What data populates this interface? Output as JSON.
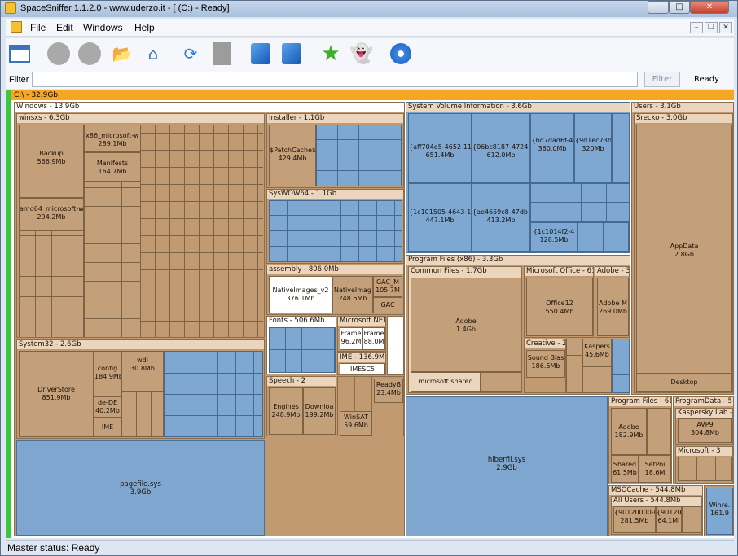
{
  "title": "SpaceSniffer 1.1.2.0 - www.uderzo.it - [ (C:) - Ready]",
  "menu": [
    "File",
    "Edit",
    "Windows",
    "Help"
  ],
  "filter": {
    "label": "Filter",
    "button": "Filter",
    "status": "Ready"
  },
  "status": "Master status: Ready",
  "root": "C:\\ - 32.9Gb",
  "windows": {
    "header": "Windows - 13.9Gb",
    "winsxs": "winsxs - 6.3Gb",
    "backup": "Backup",
    "backup_size": "566.9Mb",
    "x86ms": "x86_microsoft-w",
    "x86ms_size": "289.1Mb",
    "manifests": "Manifests",
    "manifests_size": "164.7Mb",
    "amd64ms": "amd64_microsoft-w",
    "amd64ms_size": "294.2Mb",
    "system32": "System32 - 2.6Gb",
    "driverstore": "DriverStore",
    "driverstore_size": "851.9Mb",
    "config": "config",
    "config_size": "184.9Mb",
    "dede": "de-DE",
    "dede_size": "40.2Mb",
    "ime": "IME",
    "wdi": "wdi",
    "wdi_size": "30.8Mb",
    "installer": "Installer - 1.1Gb",
    "patchcache": "$PatchCache$",
    "patchcache_size": "429.4Mb",
    "syswow": "SysWOW64 - 1.1Gb",
    "assembly": "assembly - 806.0Mb",
    "nativeimages": "NativeImages_v2",
    "nativeimages_size": "376.1Mb",
    "nativeimages2": "NativeImag",
    "nativeimages2_size": "248.6Mb",
    "gac": "GAC_M",
    "gac_size": "105.7M",
    "gac2": "GAC",
    "fonts": "Fonts - 506.6Mb",
    "dotnet": "Microsoft.NET",
    "frame": "Frame",
    "frame_size": "96.2M",
    "frame2": "Frame",
    "frame2_size": "88.0M",
    "ime2": "IME - 136.9M",
    "imesc5": "IMESC5",
    "speech": "Speech - 2",
    "engines": "Engines",
    "engines_size": "248.9Mb",
    "downloaded": "Downloa",
    "downloaded_size": "199.2Mb",
    "readyb": "ReadyB",
    "readyb_size": "23.4Mb",
    "winsat": "WinSAT",
    "winsat_size": "59.6Mb",
    "pagefile": "pagefile.sys",
    "pagefile_size": "3.9Gb"
  },
  "svi": {
    "header": "System Volume Information - 3.6Gb",
    "a": "{aff704e5-4652-11",
    "a_size": "651.4Mb",
    "b": "{06bc8187-4724-1",
    "b_size": "612.0Mb",
    "c": "{bd7dad6f-4",
    "c_size": "360.0Mb",
    "d": "{9d1ec73b",
    "d_size": "320Mb",
    "e": "{1c101505-4643-11",
    "e_size": "447.1Mb",
    "f": "{ae4659c8-47db-1",
    "f_size": "413.2Mb",
    "g": "{1c1014f2-4",
    "g_size": "128.5Mb"
  },
  "pf86": {
    "header": "Program Files (x86) - 3.3Gb",
    "common": "Common Files - 1.7Gb",
    "adobe": "Adobe",
    "adobe_size": "1.4Gb",
    "msshared": "microsoft shared",
    "office": "Microsoft Office - 61",
    "office12": "Office12",
    "office12_size": "550.4Mb",
    "adobe3": "Adobe - 3",
    "adobem": "Adobe M",
    "adobem_size": "269.0Mb",
    "creative": "Creative - 2",
    "soundblas": "Sound Blas",
    "soundblas_size": "186.6Mb",
    "kaspers": "Kaspers",
    "kaspers_size": "45.6Mb"
  },
  "users": {
    "header": "Users - 3.1Gb",
    "srecko": "Srecko - 3.0Gb",
    "appdata": "AppData",
    "appdata_size": "2.8Gb",
    "desktop": "Desktop"
  },
  "hiberfil": "hiberfil.sys",
  "hiberfil_size": "2.9Gb",
  "pf": {
    "header": "Program Files - 61",
    "adobe": "Adobe",
    "adobe_size": "182.9Mb",
    "shared": "Shared",
    "shared_size": "61.5Mb",
    "setpoi": "SetPoi",
    "setpoi_size": "18.6M"
  },
  "pd": {
    "header": "ProgramData - 5",
    "kasp": "Kaspersky Lab -",
    "avp": "AVP9",
    "avp_size": "304.8Mb",
    "ms": "Microsoft - 3"
  },
  "mso": {
    "header": "MSOCache - 544.8Mb",
    "allusers": "All Users - 544.8Mb",
    "a": "{90120000-0",
    "a_size": "281.5Mb",
    "b": "{90120",
    "b_size": "64.1MI",
    "winre": "Winre.",
    "winre_size": "161.9"
  },
  "colors": {
    "folder": "#c19a72",
    "file": "#7fa6cf",
    "root": "#f5a623",
    "green": "#39c93f"
  },
  "toolbar_icons": [
    "new-window-icon",
    "stop-icon",
    "pause-icon",
    "open-folder-icon",
    "home-icon",
    "refresh-icon",
    "file-icon",
    "cube-icon",
    "cube-alt-icon",
    "star-icon",
    "ghost-icon",
    "gear-flower-icon"
  ]
}
